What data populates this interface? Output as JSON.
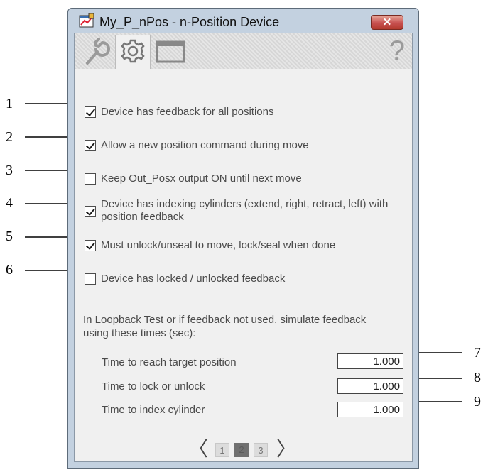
{
  "window": {
    "title": "My_P_nPos - n-Position Device",
    "close_glyph": "✕"
  },
  "toolbar": {
    "tabs": [
      {
        "icon": "wrench-icon"
      },
      {
        "icon": "gear-icon",
        "selected": true
      },
      {
        "icon": "window-icon"
      }
    ],
    "help_glyph": "?"
  },
  "options": [
    {
      "label": "Device has feedback for all positions",
      "checked": true
    },
    {
      "label": "Allow a new position command during move",
      "checked": true
    },
    {
      "label": "Keep Out_Posx output ON until next move",
      "checked": false
    },
    {
      "label": "Device has indexing cylinders (extend, right, retract, left) with position feedback",
      "checked": true
    },
    {
      "label": "Must unlock/unseal to move, lock/seal when done",
      "checked": true
    },
    {
      "label": "Device has locked / unlocked feedback",
      "checked": false
    }
  ],
  "simulation": {
    "intro": "In Loopback Test or if feedback not used, simulate feedback using these times (sec):",
    "rows": [
      {
        "label": "Time to reach target position",
        "value": "1.000"
      },
      {
        "label": "Time to lock or unlock",
        "value": "1.000"
      },
      {
        "label": "Time to index cylinder",
        "value": "1.000"
      }
    ]
  },
  "pager": {
    "prev": "〈",
    "next": "〉",
    "pages": [
      "1",
      "2",
      "3"
    ],
    "current": "2"
  },
  "callouts": [
    "1",
    "2",
    "3",
    "4",
    "5",
    "6",
    "7",
    "8",
    "9"
  ]
}
